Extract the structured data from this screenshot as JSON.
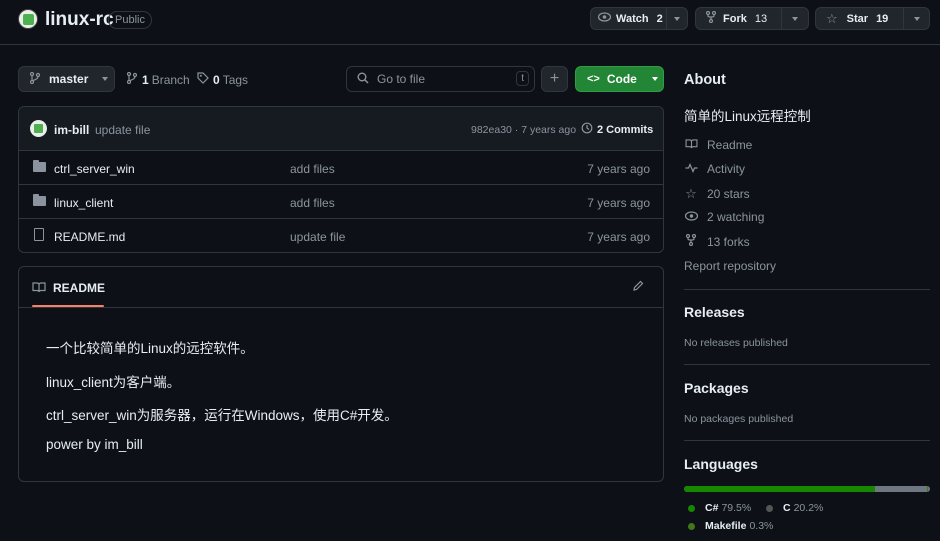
{
  "header": {
    "repo_name": "linux-rc",
    "visibility": "Public",
    "watch_label": "Watch",
    "watch_count": "2",
    "fork_label": "Fork",
    "fork_count": "13",
    "star_label": "Star",
    "star_count": "19"
  },
  "toolbar": {
    "branch": "master",
    "branches_count": "1",
    "branches_label": "Branch",
    "tags_count": "0",
    "tags_label": "Tags",
    "search_placeholder": "Go to file",
    "search_shortcut": "t",
    "add_button": "+",
    "code_button": "Code"
  },
  "commit": {
    "author": "im-bill",
    "message": "update file",
    "hash_time": "982ea30 · 7 years ago",
    "commits_count": "2",
    "commits_label": "Commits"
  },
  "files": [
    {
      "name": "ctrl_server_win",
      "type": "folder",
      "message": "add files",
      "time": "7 years ago"
    },
    {
      "name": "linux_client",
      "type": "folder",
      "message": "add files",
      "time": "7 years ago"
    },
    {
      "name": "README.md",
      "type": "file",
      "message": "update file",
      "time": "7 years ago"
    }
  ],
  "readme": {
    "title": "README",
    "lines": [
      "一个比较简单的Linux的远控软件。",
      "linux_client为客户端。",
      "ctrl_server_win为服务器，运行在Windows，使用C#开发。",
      "power by im_bill"
    ]
  },
  "about": {
    "heading": "About",
    "description": "简单的Linux远程控制",
    "readme": "Readme",
    "activity": "Activity",
    "stars": "20 stars",
    "watching": "2 watching",
    "forks": "13 forks",
    "report": "Report repository"
  },
  "releases": {
    "heading": "Releases",
    "text": "No releases published"
  },
  "packages": {
    "heading": "Packages",
    "text": "No packages published"
  },
  "languages": {
    "heading": "Languages",
    "items": [
      {
        "name": "C#",
        "percent": "79.5%",
        "value": 79.5,
        "color": "#178600"
      },
      {
        "name": "C",
        "percent": "20.2%",
        "value": 20.2,
        "color": "#555555"
      },
      {
        "name": "Makefile",
        "percent": "0.3%",
        "value": 0.3,
        "color": "#427819"
      }
    ]
  },
  "colors": {
    "code_button": "#238636",
    "accent_link": "#2f81f7",
    "bg": "#0d1117",
    "border": "#30363d"
  }
}
